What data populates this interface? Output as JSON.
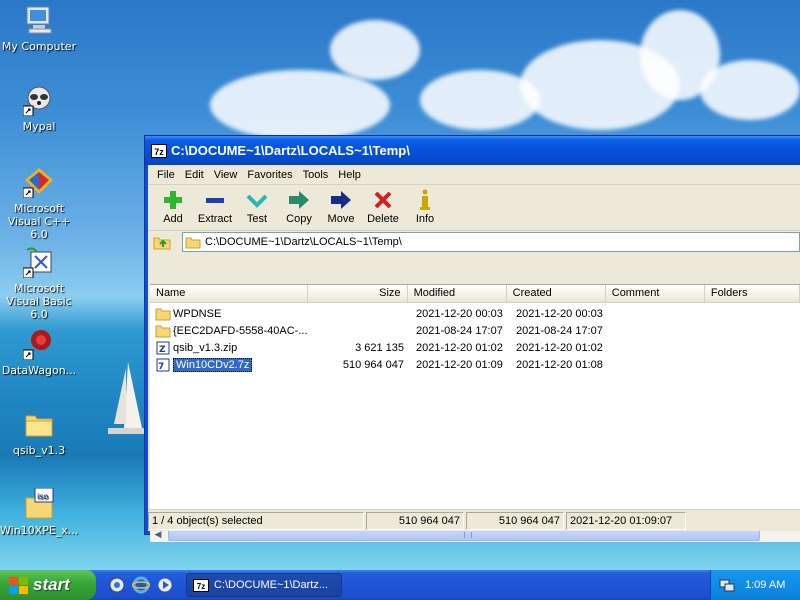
{
  "desktop": {
    "icons": [
      {
        "label": "My Computer",
        "icon": "my-computer-icon"
      },
      {
        "label": "Mypal",
        "icon": "mypal-raccoon-icon"
      },
      {
        "label": "Microsoft Visual C++ 6.0",
        "icon": "visual-cpp-icon"
      },
      {
        "label": "Microsoft Visual Basic 6.0",
        "icon": "visual-basic-icon"
      },
      {
        "label": "DataWagon...",
        "icon": "datawagon-icon"
      },
      {
        "label": "qsib_v1.3",
        "icon": "folder-icon"
      },
      {
        "label": "Win10XPE_x...",
        "icon": "iso-file-icon"
      }
    ]
  },
  "window": {
    "title": "C:\\DOCUME~1\\Dartz\\LOCALS~1\\Temp\\",
    "app_icon_text": "7z",
    "menu": [
      "File",
      "Edit",
      "View",
      "Favorites",
      "Tools",
      "Help"
    ],
    "toolbar": [
      {
        "label": "Add",
        "icon": "add-icon",
        "color": "#2fb52f"
      },
      {
        "label": "Extract",
        "icon": "extract-icon",
        "color": "#1e3fae"
      },
      {
        "label": "Test",
        "icon": "test-icon",
        "color": "#2bb5b5"
      },
      {
        "label": "Copy",
        "icon": "copy-icon",
        "color": "#2a8a6a"
      },
      {
        "label": "Move",
        "icon": "move-icon",
        "color": "#1a2b8a"
      },
      {
        "label": "Delete",
        "icon": "delete-icon",
        "color": "#d02020"
      },
      {
        "label": "Info",
        "icon": "info-icon",
        "color": "#c9a800"
      }
    ],
    "address": "C:\\DOCUME~1\\Dartz\\LOCALS~1\\Temp\\",
    "columns": [
      "Name",
      "Size",
      "Modified",
      "Created",
      "Comment",
      "Folders"
    ],
    "rows": [
      {
        "name": "WPDNSE",
        "type": "folder",
        "size": "",
        "modified": "2021-12-20 00:03",
        "created": "2021-12-20 00:03",
        "selected": false
      },
      {
        "name": "{EEC2DAFD-5558-40AC-...",
        "type": "folder",
        "size": "",
        "modified": "2021-08-24 17:07",
        "created": "2021-08-24 17:07",
        "selected": false
      },
      {
        "name": "qsib_v1.3.zip",
        "type": "archive",
        "size": "3 621 135",
        "modified": "2021-12-20 01:02",
        "created": "2021-12-20 01:02",
        "selected": false
      },
      {
        "name": "Win10CDv2.7z",
        "type": "archive",
        "size": "510 964 047",
        "modified": "2021-12-20 01:09",
        "created": "2021-12-20 01:08",
        "selected": true
      }
    ],
    "status": {
      "selection": "1 / 4 object(s) selected",
      "size1": "510 964 047",
      "size2": "510 964 047",
      "datetime": "2021-12-20 01:09:07"
    }
  },
  "taskbar": {
    "start_label": "start",
    "task_label": "C:\\DOCUME~1\\Dartz...",
    "task_icon_text": "7z",
    "clock": "1:09 AM"
  }
}
